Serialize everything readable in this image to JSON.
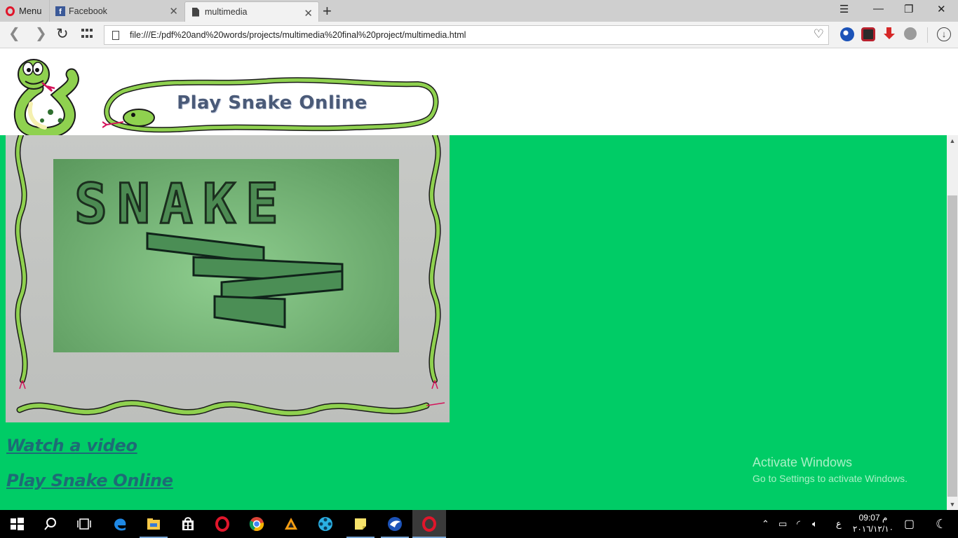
{
  "browser": {
    "menu_label": "Menu",
    "tabs": [
      {
        "title": "Facebook"
      },
      {
        "title": "multimedia"
      }
    ],
    "address_url": "file:///E:/pdf%20and%20words/projects/multimedia%20final%20project/multimedia.html"
  },
  "page": {
    "banner_title": "Play Snake Online",
    "hero_image_word": "SNAKE",
    "links": [
      {
        "label": "Watch a video"
      },
      {
        "label": "Play Snake Online"
      }
    ],
    "background_color": "#00cc66",
    "link_color": "#1e6b76"
  },
  "watermark": {
    "title": "Activate Windows",
    "subtitle": "Go to Settings to activate Windows."
  },
  "taskbar": {
    "apps": [
      "start-icon",
      "search-icon",
      "task-view-icon",
      "edge-icon",
      "file-explorer-icon",
      "store-icon",
      "opera-icon",
      "chrome-icon",
      "vlc-like-icon",
      "film-reel-icon",
      "sticky-notes-icon",
      "eagle-app-icon",
      "opera-active-icon"
    ],
    "lang": "ع",
    "time": "09:07 م",
    "date": "٢٠١٦/١٢/١٠"
  }
}
